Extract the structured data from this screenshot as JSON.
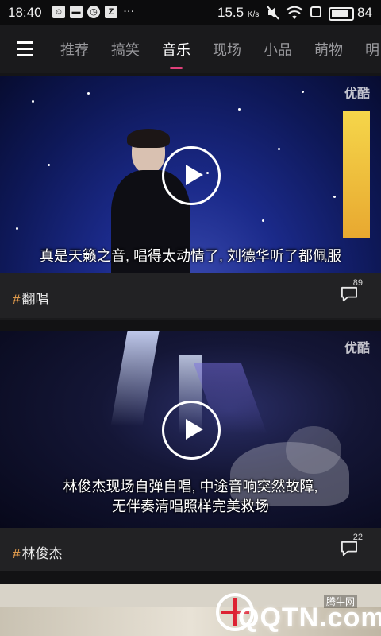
{
  "status_bar": {
    "time": "18:40",
    "speed": "15.5",
    "speed_unit": "K/s",
    "battery": "84",
    "dots": "···"
  },
  "nav": {
    "tabs": [
      {
        "label": "推荐",
        "active": false
      },
      {
        "label": "搞笑",
        "active": false
      },
      {
        "label": "音乐",
        "active": true
      },
      {
        "label": "现场",
        "active": false
      },
      {
        "label": "小品",
        "active": false
      },
      {
        "label": "萌物",
        "active": false
      },
      {
        "label": "明",
        "active": false
      }
    ]
  },
  "feed": [
    {
      "logo": "优酷",
      "caption_lines": [
        "真是天籁之音, 唱得太动情了, 刘德华听了都佩服"
      ],
      "tag_mark": "#",
      "tag": "翻唱",
      "comment_count": "89"
    },
    {
      "logo": "优酷",
      "caption_lines": [
        "林俊杰现场自弹自唱, 中途音响突然故障,",
        "无伴奏清唱照样完美救场"
      ],
      "tag_mark": "#",
      "tag": "林俊杰",
      "comment_count": "22"
    }
  ],
  "watermark": {
    "brand": "QQTN.com",
    "site": "腾牛网"
  },
  "colors": {
    "accent": "#e0407a",
    "tag_hash": "#e9a04e",
    "background": "#151517"
  }
}
